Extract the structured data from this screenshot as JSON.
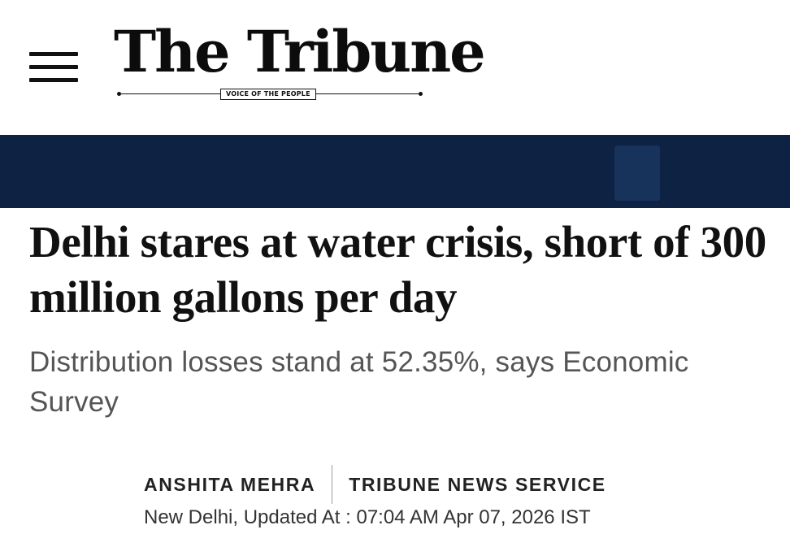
{
  "header": {
    "menu_icon": "hamburger-menu-icon",
    "logo_title": "The Tribune",
    "logo_tagline": "VOICE OF THE PEOPLE"
  },
  "banner": {
    "color": "#0e2244"
  },
  "article": {
    "headline": "Delhi stares at water crisis, short of 300 million gallons per day",
    "subheadline": "Distribution losses stand at 52.35%, says Economic Survey",
    "author": "ANSHITA MEHRA",
    "agency": "TRIBUNE NEWS SERVICE",
    "dateline": "New Delhi, Updated At : 07:04 AM Apr 07, 2026 IST"
  }
}
